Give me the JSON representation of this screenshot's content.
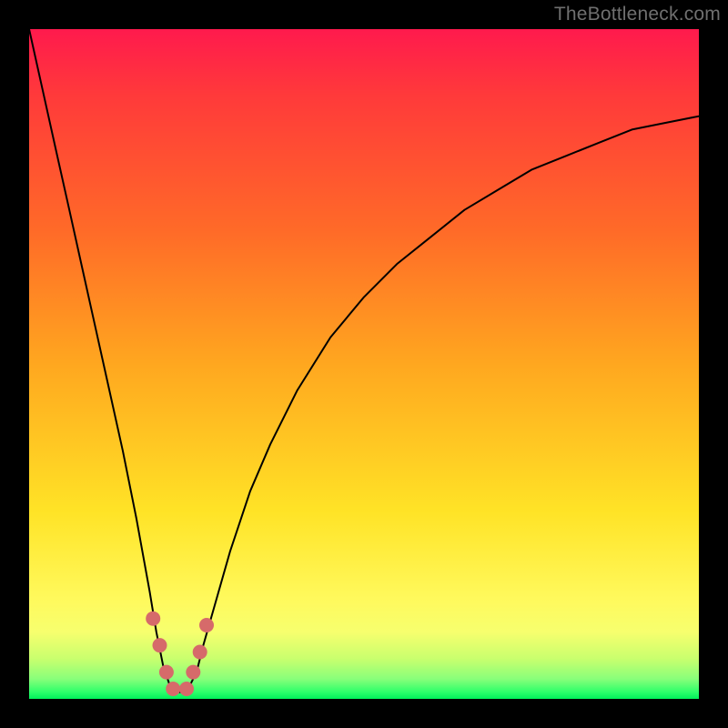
{
  "watermark": "TheBottleneck.com",
  "chart_data": {
    "type": "line",
    "title": "",
    "xlabel": "",
    "ylabel": "",
    "xlim": [
      0,
      100
    ],
    "ylim": [
      0,
      100
    ],
    "series": [
      {
        "name": "bottleneck-curve",
        "x": [
          0,
          2,
          4,
          6,
          8,
          10,
          12,
          14,
          16,
          18,
          19,
          20,
          21,
          22,
          23,
          24,
          25,
          26,
          28,
          30,
          33,
          36,
          40,
          45,
          50,
          55,
          60,
          65,
          70,
          75,
          80,
          85,
          90,
          95,
          100
        ],
        "values": [
          100,
          91,
          82,
          73,
          64,
          55,
          46,
          37,
          27,
          16,
          10,
          5,
          2,
          1,
          1,
          2,
          4,
          8,
          15,
          22,
          31,
          38,
          46,
          54,
          60,
          65,
          69,
          73,
          76,
          79,
          81,
          83,
          85,
          86,
          87
        ]
      }
    ],
    "markers": {
      "name": "curve-highlight-markers",
      "x": [
        18.5,
        19.5,
        20.5,
        21.5,
        23.5,
        24.5,
        25.5,
        26.5
      ],
      "values": [
        12,
        8,
        4,
        1.5,
        1.5,
        4,
        7,
        11
      ]
    },
    "gradient_meaning": "background color encodes bottleneck severity: green (low) at bottom to red (high) at top"
  }
}
